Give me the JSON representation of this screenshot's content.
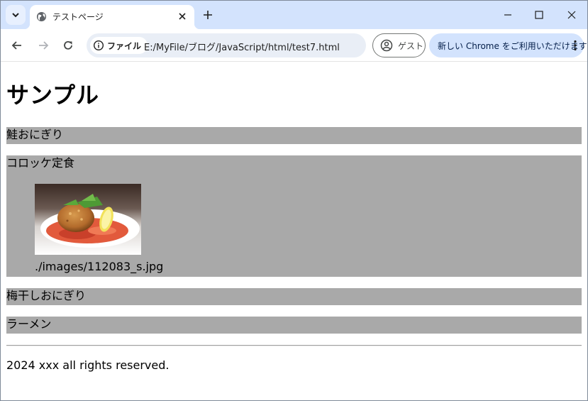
{
  "window": {
    "tab_title": "テストページ"
  },
  "toolbar": {
    "site_chip_label": "ファイル",
    "url": "E:/MyFile/ブログ/JavaScript/html/test7.html",
    "guest_label": "ゲスト",
    "promo_label": "新しい Chrome をご利用いただけます"
  },
  "page": {
    "heading": "サンプル",
    "items": [
      {
        "label": "鮭おにぎり"
      },
      {
        "label": "コロッケ定食",
        "image_path": "./images/112083_s.jpg"
      },
      {
        "label": "梅干しおにぎり"
      },
      {
        "label": "ラーメン"
      }
    ],
    "footer": "2024 xxx all rights reserved."
  },
  "colors": {
    "tab_strip": "#d3e3fd",
    "item_background": "#a9a9a9",
    "omnibox": "#e9eef6"
  }
}
